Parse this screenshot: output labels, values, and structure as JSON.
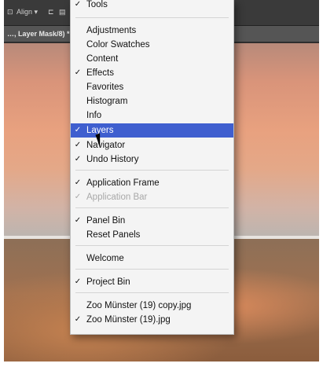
{
  "toolbar": {
    "align_label": "Align ▾"
  },
  "document": {
    "tab_title": "…, Layer Mask/8) *"
  },
  "menu": {
    "items": [
      {
        "label": "Tools",
        "checked": true,
        "disabled": false,
        "highlighted": false
      },
      {
        "label": "Adjustments",
        "checked": false,
        "disabled": false,
        "highlighted": false
      },
      {
        "label": "Color Swatches",
        "checked": false,
        "disabled": false,
        "highlighted": false
      },
      {
        "label": "Content",
        "checked": false,
        "disabled": false,
        "highlighted": false
      },
      {
        "label": "Effects",
        "checked": true,
        "disabled": false,
        "highlighted": false
      },
      {
        "label": "Favorites",
        "checked": false,
        "disabled": false,
        "highlighted": false
      },
      {
        "label": "Histogram",
        "checked": false,
        "disabled": false,
        "highlighted": false
      },
      {
        "label": "Info",
        "checked": false,
        "disabled": false,
        "highlighted": false
      },
      {
        "label": "Layers",
        "checked": true,
        "disabled": false,
        "highlighted": true
      },
      {
        "label": "Navigator",
        "checked": true,
        "disabled": false,
        "highlighted": false
      },
      {
        "label": "Undo History",
        "checked": true,
        "disabled": false,
        "highlighted": false
      },
      {
        "label": "Application Frame",
        "checked": true,
        "disabled": false,
        "highlighted": false
      },
      {
        "label": "Application Bar",
        "checked": true,
        "disabled": true,
        "highlighted": false
      },
      {
        "label": "Panel Bin",
        "checked": true,
        "disabled": false,
        "highlighted": false
      },
      {
        "label": "Reset Panels",
        "checked": false,
        "disabled": false,
        "highlighted": false
      },
      {
        "label": "Welcome",
        "checked": false,
        "disabled": false,
        "highlighted": false
      },
      {
        "label": "Project Bin",
        "checked": true,
        "disabled": false,
        "highlighted": false
      },
      {
        "label": "Zoo Münster (19) copy.jpg",
        "checked": false,
        "disabled": false,
        "highlighted": false
      },
      {
        "label": "Zoo Münster (19).jpg",
        "checked": true,
        "disabled": false,
        "highlighted": false
      }
    ]
  },
  "colors": {
    "highlight": "#3f5fcf",
    "menu_bg": "#f4f4f4",
    "disabled_text": "#a8a8a8"
  }
}
